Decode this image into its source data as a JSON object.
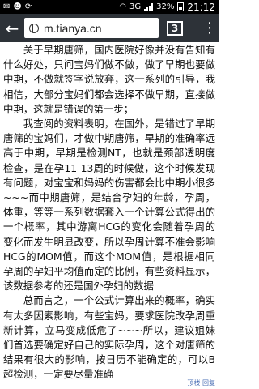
{
  "status_bar": {
    "network": "3G",
    "battery": "32%",
    "time": "21:12"
  },
  "toolbar": {
    "url": "m.tianya.cn",
    "tab_count": "3"
  },
  "article": {
    "paragraphs": [
      "关于早期唐筛，国内医院好像并没有告知有什么好处，只问宝妈们做不做，做了早期也要做中期，不做就签字说放弃，这一系列的引导，我相信，大部分宝妈们都会选择不做早期，直接做中期，这就是错误的第一步；",
      "我查阅的资料表明，在国外，是错过了早期唐筛的宝妈们，才做中期唐筛，早期的准确率远高于中期，早期是检测NT，也就是颈部透明度检查，是在孕11-13周的时候做，这个时候发现有问题，对宝宝和妈妈的伤害都会比中期小很多~~~而中期唐筛，是结合孕妇的年龄，孕周，体重，等等一系列数据套入一个计算公式得出的一个概率，其中游离HCG的变化会随着孕周的变化而发生明显改变，所以孕周计算不准会影响HCG的MOM值，而这个MOM值，是根据相同孕周的孕妇平均值而定的比例，有些资料显示，该数据参考的还是国外孕妇的数据",
      "总而言之，一个公式计算出来的概率，确实有太多因素影响，有些宝妈，要求医院改孕周重新计算，立马变成低危了~~~所以，建议姐妹们首选要确定好自己的实际孕周，这个对唐筛的结果有很大的影响，按日历不能确定的，可以B超检测，一定要尽量准确"
    ]
  },
  "footer": {
    "text": "顶楼 回复"
  }
}
